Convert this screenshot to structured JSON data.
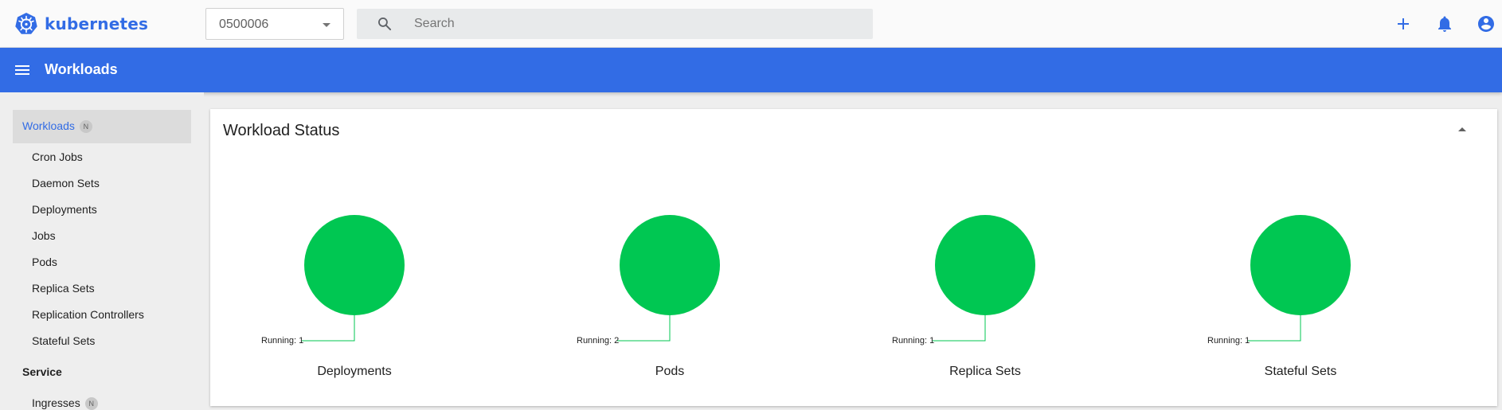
{
  "app": {
    "name": "kubernetes"
  },
  "header": {
    "namespace": "0500006",
    "search_placeholder": "Search"
  },
  "bar": {
    "title": "Workloads"
  },
  "sidebar": {
    "active": {
      "label": "Workloads",
      "badge": "N"
    },
    "items": [
      {
        "label": "Cron Jobs"
      },
      {
        "label": "Daemon Sets"
      },
      {
        "label": "Deployments"
      },
      {
        "label": "Jobs"
      },
      {
        "label": "Pods"
      },
      {
        "label": "Replica Sets"
      },
      {
        "label": "Replication Controllers"
      },
      {
        "label": "Stateful Sets"
      }
    ],
    "section": "Service",
    "section_items": [
      {
        "label": "Ingresses",
        "badge": "N"
      }
    ]
  },
  "card": {
    "title": "Workload Status"
  },
  "charts": [
    {
      "name": "Deployments",
      "running_label": "Running: 1",
      "running": 1
    },
    {
      "name": "Pods",
      "running_label": "Running: 2",
      "running": 2
    },
    {
      "name": "Replica Sets",
      "running_label": "Running: 1",
      "running": 1
    },
    {
      "name": "Stateful Sets",
      "running_label": "Running: 1",
      "running": 1
    }
  ],
  "colors": {
    "brand": "#326ce5",
    "running": "#00c752"
  },
  "icons": [
    "kubernetes-logo",
    "search-icon",
    "plus-icon",
    "bell-icon",
    "account-icon",
    "menu-icon",
    "chevron-down-icon",
    "chevron-up-icon"
  ]
}
